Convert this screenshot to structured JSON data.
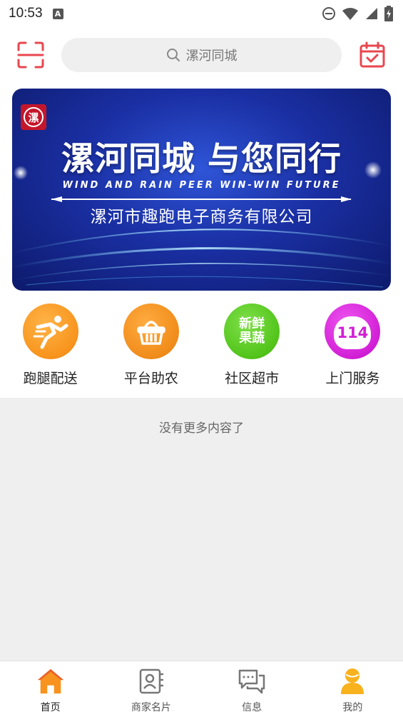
{
  "status_bar": {
    "time": "10:53",
    "notification_letter": "A"
  },
  "header": {
    "search_placeholder": "漯河同城"
  },
  "banner": {
    "logo_char": "漯",
    "title": "漯河同城  与您同行",
    "subtitle_en": "WIND AND RAIN PEER WIN-WIN FUTURE",
    "company": "漯河市趣跑电子商务有限公司"
  },
  "categories": [
    {
      "label": "跑腿配送",
      "icon": "runner-icon",
      "color": "#f7941d"
    },
    {
      "label": "平台助农",
      "icon": "basket-icon",
      "color": "#f08c1a"
    },
    {
      "label": "社区超市",
      "icon": "fresh-produce-icon",
      "color": "#52c41a",
      "icon_text_line1": "新鲜",
      "icon_text_line2": "果蔬"
    },
    {
      "label": "上门服务",
      "icon": "service-114-icon",
      "color": "#d21fd6",
      "icon_text": "114"
    }
  ],
  "content": {
    "empty_text": "没有更多内容了"
  },
  "bottom_nav": [
    {
      "label": "首页",
      "icon": "home-icon",
      "active": true
    },
    {
      "label": "商家名片",
      "icon": "contacts-icon",
      "active": false
    },
    {
      "label": "信息",
      "icon": "message-icon",
      "active": false
    },
    {
      "label": "我的",
      "icon": "user-icon",
      "active": false
    }
  ],
  "colors": {
    "accent": "#f5722a",
    "nav_active": "#f7931e",
    "banner": "#1a2fa3"
  }
}
